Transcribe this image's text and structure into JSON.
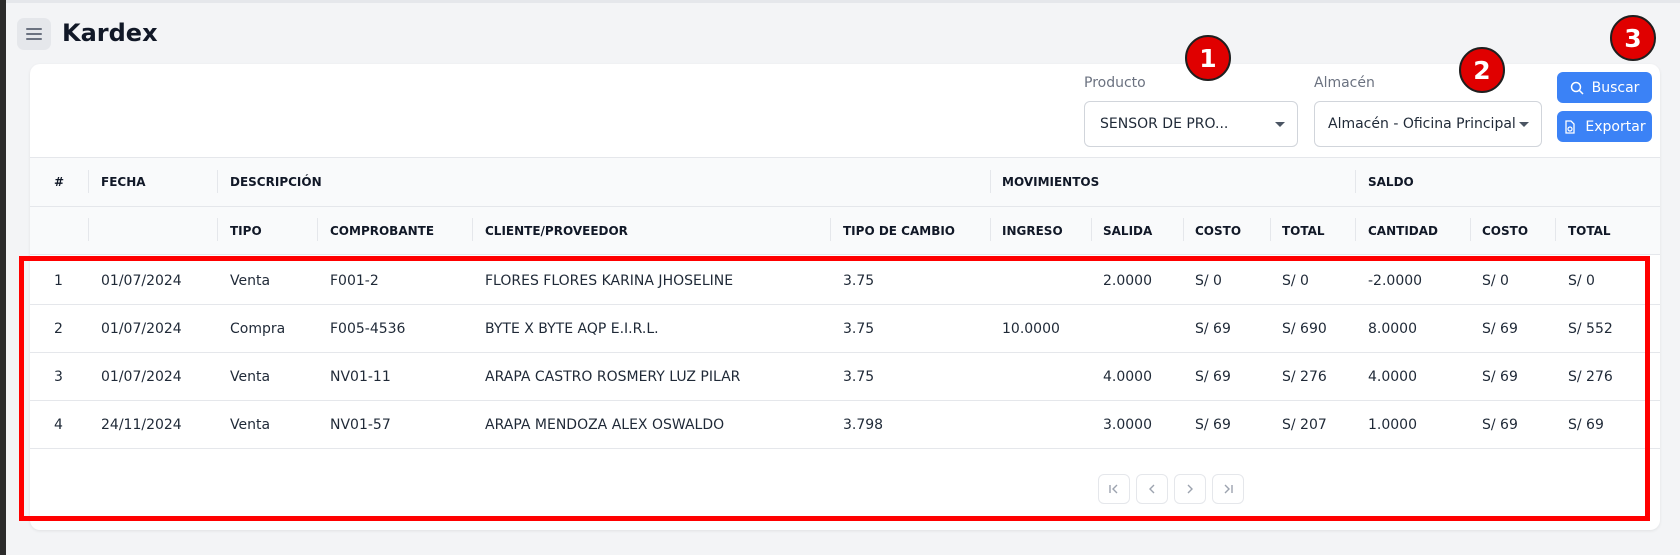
{
  "page": {
    "title": "Kardex"
  },
  "filters": {
    "producto": {
      "label": "Producto",
      "value": "SENSOR DE PRO..."
    },
    "almacen": {
      "label": "Almacén",
      "value": "Almacén - Oficina Principal"
    }
  },
  "actions": {
    "buscar": "Buscar",
    "exportar": "Exportar"
  },
  "annotations": [
    "1",
    "2",
    "3"
  ],
  "table": {
    "group_headers": {
      "num": "#",
      "fecha": "FECHA",
      "descripcion": "DESCRIPCIÓN",
      "movimientos": "MOVIMIENTOS",
      "saldo": "SALDO"
    },
    "sub_headers": {
      "tipo": "TIPO",
      "comprobante": "COMPROBANTE",
      "cliente": "CLIENTE/PROVEEDOR",
      "tipo_cambio": "TIPO DE CAMBIO",
      "ingreso": "INGRESO",
      "salida": "SALIDA",
      "costo": "COSTO",
      "total": "TOTAL",
      "cantidad": "CANTIDAD",
      "saldo_costo": "COSTO",
      "saldo_total": "TOTAL"
    },
    "rows": [
      {
        "num": "1",
        "fecha": "01/07/2024",
        "tipo": "Venta",
        "comprobante": "F001-2",
        "cliente": "FLORES FLORES KARINA JHOSELINE",
        "tipo_cambio": "3.75",
        "ingreso": "",
        "salida": "2.0000",
        "costo": "S/ 0",
        "total": "S/ 0",
        "cantidad": "-2.0000",
        "saldo_costo": "S/ 0",
        "saldo_total": "S/ 0"
      },
      {
        "num": "2",
        "fecha": "01/07/2024",
        "tipo": "Compra",
        "comprobante": "F005-4536",
        "cliente": "BYTE X BYTE AQP E.I.R.L.",
        "tipo_cambio": "3.75",
        "ingreso": "10.0000",
        "salida": "",
        "costo": "S/ 69",
        "total": "S/ 690",
        "cantidad": "8.0000",
        "saldo_costo": "S/ 69",
        "saldo_total": "S/ 552"
      },
      {
        "num": "3",
        "fecha": "01/07/2024",
        "tipo": "Venta",
        "comprobante": "NV01-11",
        "cliente": "ARAPA CASTRO ROSMERY LUZ PILAR",
        "tipo_cambio": "3.75",
        "ingreso": "",
        "salida": "4.0000",
        "costo": "S/ 69",
        "total": "S/ 276",
        "cantidad": "4.0000",
        "saldo_costo": "S/ 69",
        "saldo_total": "S/ 276"
      },
      {
        "num": "4",
        "fecha": "24/11/2024",
        "tipo": "Venta",
        "comprobante": "NV01-57",
        "cliente": "ARAPA MENDOZA ALEX OSWALDO",
        "tipo_cambio": "3.798",
        "ingreso": "",
        "salida": "3.0000",
        "costo": "S/ 69",
        "total": "S/ 207",
        "cantidad": "1.0000",
        "saldo_costo": "S/ 69",
        "saldo_total": "S/ 69"
      }
    ]
  },
  "colors": {
    "primary": "#3b82f6",
    "annotation": "#e00000",
    "highlight_border": "#ff0000"
  }
}
